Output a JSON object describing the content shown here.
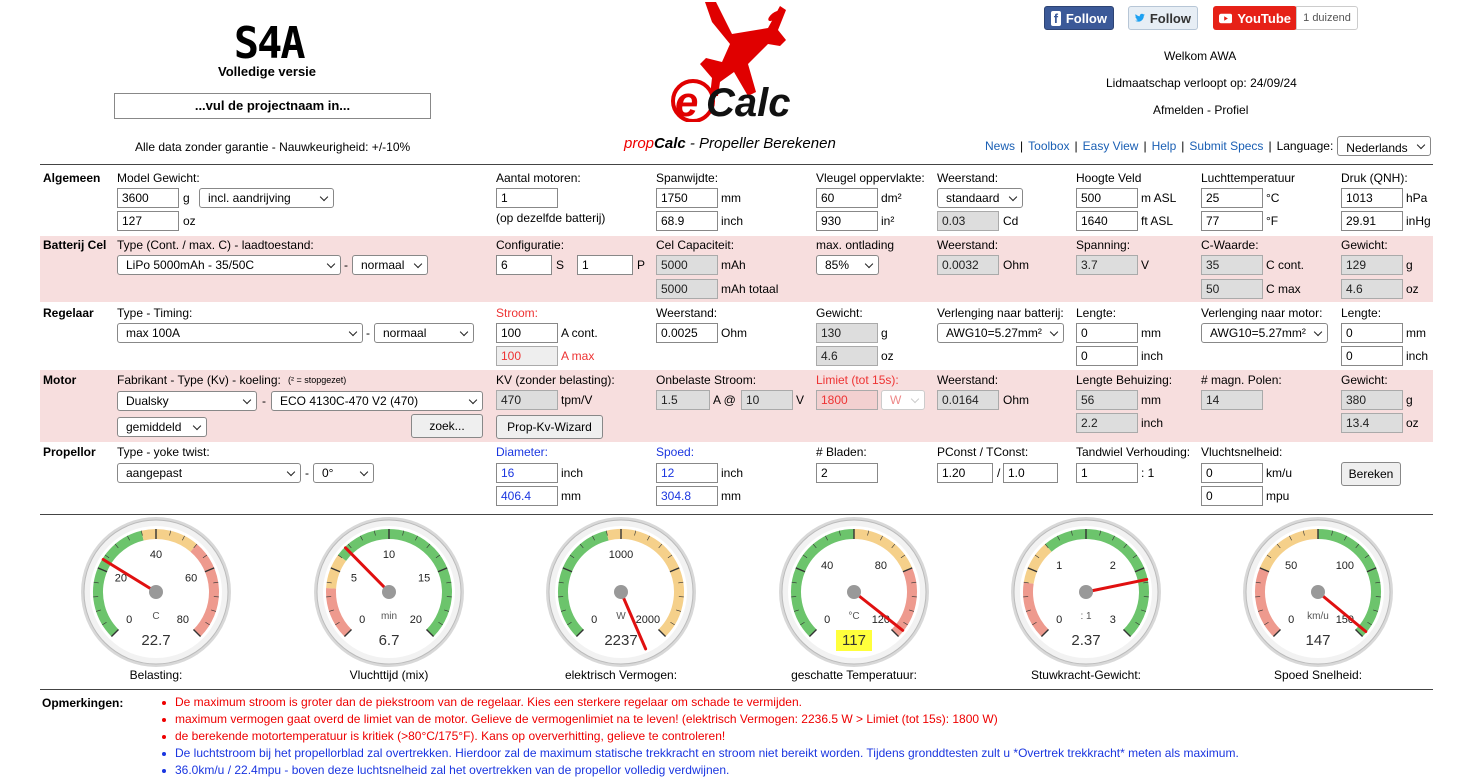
{
  "header": {
    "logo_text": "S4A",
    "version": "Volledige versie",
    "project_placeholder": "...vul de projectnaam in...",
    "disclaimer": "Alle data zonder garantie - Nauwkeurigheid: +/-10%",
    "app_logo": "eCalc",
    "subtitle_prefix": "prop",
    "subtitle_bold": "Calc",
    "subtitle_rest": " - Propeller Berekenen"
  },
  "social": {
    "facebook_label": "Follow",
    "twitter_label": "Follow",
    "youtube_label": "YouTube",
    "youtube_count": "1 duizend"
  },
  "account": {
    "welcome": "Welkom AWA",
    "membership": "Lidmaatschap verloopt op: 24/09/24",
    "logout": "Afmelden",
    "profile": "Profiel",
    "logout_sep": " - "
  },
  "nav": {
    "items": [
      "News",
      "Toolbox",
      "Easy View",
      "Help",
      "Submit Specs"
    ],
    "language_label": "Language:",
    "language_value": "Nederlands"
  },
  "algemeen": {
    "section": "Algemeen",
    "model_weight_label": "Model Gewicht:",
    "weight_g": "3600",
    "unit_g": "g",
    "weight_mode": "incl. aandrijving",
    "weight_oz": "127",
    "unit_oz": "oz",
    "motors_label": "Aantal motoren:",
    "motors": "1",
    "motors_note": "(op dezelfde batterij)",
    "span_label": "Spanwijdte:",
    "span_mm": "1750",
    "unit_mm": "mm",
    "span_inch": "68.9",
    "unit_inch": "inch",
    "wing_label": "Vleugel oppervlakte:",
    "wing_dm2": "60",
    "unit_dm2": "dm²",
    "wing_in2": "930",
    "unit_in2": "in²",
    "drag_label": "Weerstand:",
    "drag": "standaard",
    "cd": "0.03",
    "unit_cd": "Cd",
    "height_label": "Hoogte Veld",
    "height_m": "500",
    "unit_masl": "m ASL",
    "height_ft": "1640",
    "unit_ftasl": "ft ASL",
    "temp_label": "Luchttemperatuur",
    "temp_c": "25",
    "unit_c": "°C",
    "temp_f": "77",
    "unit_f": "°F",
    "pressure_label": "Druk (QNH):",
    "pressure_hpa": "1013",
    "unit_hpa": "hPa",
    "pressure_inhg": "29.91",
    "unit_inhg": "inHg"
  },
  "batterij": {
    "section": "Batterij Cel",
    "type_label": "Type (Cont. / max. C) - laadtoestand:",
    "type": "LiPo 5000mAh - 35/50C",
    "dash": "-",
    "state": "normaal",
    "config_label": "Configuratie:",
    "s": "6",
    "unit_s": "S",
    "p": "1",
    "unit_p": "P",
    "capacity_label": "Cel Capaciteit:",
    "capacity": "5000",
    "unit_mah": "mAh",
    "capacity_total": "5000",
    "unit_mah_total": "mAh totaal",
    "discharge_label": "max. ontlading",
    "discharge": "85%",
    "resistance_label": "Weerstand:",
    "resistance": "0.0032",
    "unit_ohm": "Ohm",
    "voltage_label": "Spanning:",
    "voltage": "3.7",
    "unit_v": "V",
    "crate_label": "C-Waarde:",
    "c_cont": "35",
    "unit_ccont": "C cont.",
    "c_max": "50",
    "unit_cmax": "C max",
    "weight_label": "Gewicht:",
    "weight_g": "129",
    "unit_g": "g",
    "weight_oz": "4.6",
    "unit_oz": "oz"
  },
  "regelaar": {
    "section": "Regelaar",
    "type_label": "Type - Timing:",
    "type": "max 100A",
    "dash": "-",
    "timing": "normaal",
    "current_label": "Stroom:",
    "current_cont": "100",
    "unit_acont": "A cont.",
    "current_max": "100",
    "unit_amax": "A max",
    "resistance_label": "Weerstand:",
    "resistance": "0.0025",
    "unit_ohm": "Ohm",
    "weight_label": "Gewicht:",
    "weight_g": "130",
    "unit_g": "g",
    "weight_oz": "4.6",
    "unit_oz": "oz",
    "ext_batt_label": "Verlenging naar batterij:",
    "ext_batt": "AWG10=5.27mm²",
    "length_label": "Lengte:",
    "length_mm": "0",
    "unit_mm": "mm",
    "length_inch": "0",
    "unit_inch": "inch",
    "ext_motor_label": "Verlenging naar motor:",
    "ext_motor": "AWG10=5.27mm²",
    "length2_label": "Lengte:",
    "length2_mm": "0",
    "unit2_mm": "mm",
    "length2_inch": "0",
    "unit2_inch": "inch"
  },
  "motor": {
    "section": "Motor",
    "type_label": "Fabrikant - Type (Kv) - koeling:",
    "type_note": "(² = stopgezet)",
    "manufacturer": "Dualsky",
    "dash": "-",
    "model": "ECO 4130C-470 V2 (470)",
    "cooling": "gemiddeld",
    "search_button": "zoek...",
    "kv_label": "KV (zonder belasting):",
    "kv": "470",
    "unit_kv": "tpm/V",
    "wizard_button": "Prop-Kv-Wizard",
    "noload_label": "Onbelaste Stroom:",
    "noload_a": "1.5",
    "unit_a_at": "A @",
    "noload_v": "10",
    "unit_v": "V",
    "limit_label": "Limiet (tot 15s):",
    "limit": "1800",
    "limit_unit": "W",
    "resistance_label": "Weerstand:",
    "resistance": "0.0164",
    "unit_ohm": "Ohm",
    "case_label": "Lengte Behuizing:",
    "case_mm": "56",
    "unit_mm": "mm",
    "case_inch": "2.2",
    "unit_inch": "inch",
    "poles_label": "# magn. Polen:",
    "poles": "14",
    "weight_label": "Gewicht:",
    "weight_g": "380",
    "unit_g": "g",
    "weight_oz": "13.4",
    "unit_oz": "oz"
  },
  "propellor": {
    "section": "Propellor",
    "type_label": "Type - yoke twist:",
    "type": "aangepast",
    "dash": "-",
    "twist": "0°",
    "diameter_label": "Diameter:",
    "diameter_inch": "16",
    "unit_inch": "inch",
    "diameter_mm": "406.4",
    "unit_mm": "mm",
    "pitch_label": "Spoed:",
    "pitch_inch": "12",
    "unit_pitch_inch": "inch",
    "pitch_mm": "304.8",
    "unit_pitch_mm": "mm",
    "blades_label": "# Bladen:",
    "blades": "2",
    "pconst_label": "PConst / TConst:",
    "pconst": "1.20",
    "slash": "/",
    "tconst": "1.0",
    "gear_label": "Tandwiel Verhouding:",
    "gear": "1",
    "gear_suffix": ": 1",
    "speed_label": "Vluchtsnelheid:",
    "speed_kmh": "0",
    "unit_kmh": "km/u",
    "speed_mph": "0",
    "unit_mph": "mpu",
    "calc_button": "Bereken"
  },
  "gauges": [
    {
      "label": "Belasting:",
      "value": "22.7",
      "unit": "C",
      "ticks": [
        "0",
        "20",
        "40",
        "60",
        "80"
      ],
      "min": 0,
      "max": 80,
      "reading": 22.7,
      "highlight": false
    },
    {
      "label": "Vluchttijd (mix)",
      "value": "6.7",
      "unit": "min",
      "ticks": [
        "0",
        "5",
        "10",
        "15",
        "20"
      ],
      "min": 0,
      "max": 20,
      "reading": 6.7,
      "highlight": false
    },
    {
      "label": "elektrisch Vermogen:",
      "value": "2237",
      "unit": "W",
      "ticks": [
        "0",
        "1000",
        "2000"
      ],
      "min": 0,
      "max": 2000,
      "reading": 2237,
      "highlight": false
    },
    {
      "label": "geschatte Temperatuur:",
      "value": "117",
      "unit": "°C",
      "ticks": [
        "0",
        "40",
        "80",
        "120"
      ],
      "min": 0,
      "max": 120,
      "reading": 117,
      "highlight": true
    },
    {
      "label": "Stuwkracht-Gewicht:",
      "value": "2.37",
      "unit": ": 1",
      "ticks": [
        "0",
        "1",
        "2",
        "3"
      ],
      "min": 0,
      "max": 3,
      "reading": 2.37,
      "highlight": false
    },
    {
      "label": "Spoed Snelheid:",
      "value": "147",
      "unit": "km/u",
      "ticks": [
        "0",
        "50",
        "100",
        "150"
      ],
      "min": 0,
      "max": 150,
      "reading": 147,
      "highlight": false
    }
  ],
  "remarks": {
    "title": "Opmerkingen:",
    "items": [
      {
        "text": "De maximum stroom is groter dan de piekstroom van de regelaar. Kies een sterkere regelaar om schade te vermijden.",
        "color": "red"
      },
      {
        "text": "maximum vermogen gaat overd de limiet van de motor. Gelieve de vermogenlimiet na te leven! (elektrisch Vermogen: 2236.5 W > Limiet (tot 15s): 1800 W)",
        "color": "red"
      },
      {
        "text": "de berekende motortemperatuur is kritiek (>80°C/175°F). Kans op oververhitting, gelieve te controleren!",
        "color": "red"
      },
      {
        "text": "De luchtstroom bij het propellorblad zal overtrekken. Hierdoor zal de maximum statische trekkracht en stroom niet bereikt worden. Tijdens gronddtesten zult u *Overtrek trekkracht* meten als maximum.",
        "color": "blue"
      },
      {
        "text": "36.0km/u / 22.4mpu - boven deze luchtsnelheid zal het overtrekken van de propellor volledig verdwijnen.",
        "color": "blue"
      }
    ]
  },
  "colors": {
    "accent_red": "#e00000",
    "link_blue": "#1a5fb4",
    "band_pink": "#f7dede",
    "highlight_yellow": "#ffff3c"
  }
}
